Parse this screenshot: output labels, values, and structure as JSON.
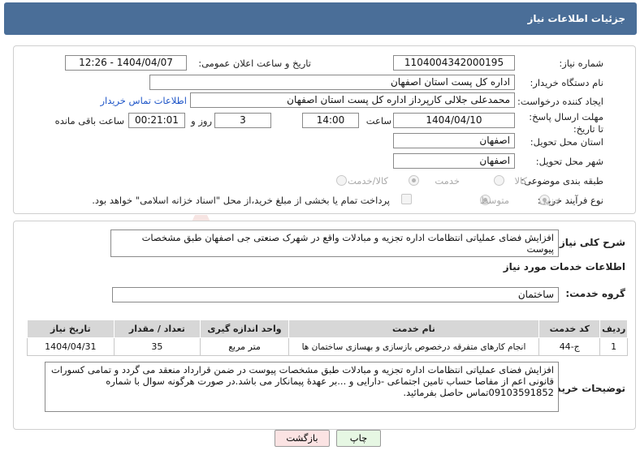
{
  "header": {
    "title": "جزئیات اطلاعات نیاز"
  },
  "fields": {
    "need_number_label": "شماره نیاز:",
    "need_number": "1104004342000195",
    "announce_label": "تاریخ و ساعت اعلان عمومی:",
    "announce_value": "1404/04/07 - 12:26",
    "buyer_org_label": "نام دستگاه خریدار:",
    "buyer_org": "اداره کل پست استان اصفهان",
    "creator_label": "ایجاد کننده درخواست:",
    "creator": "محمدعلی جلالی کارپرداز اداره کل پست استان اصفهان",
    "buyer_contact_link": "اطلاعات تماس خریدار",
    "deadline_label": "مهلت ارسال پاسخ: تا تاریخ:",
    "deadline_date": "1404/04/10",
    "time_label": "ساعت",
    "deadline_time": "14:00",
    "days_value": "3",
    "days_label": "روز و",
    "remaining_time": "00:21:01",
    "remaining_label": "ساعت باقی مانده",
    "province_label": "استان محل تحویل:",
    "province": "اصفهان",
    "city_label": "شهر محل تحویل:",
    "city": "اصفهان",
    "category_label": "طبقه بندی موضوعی:",
    "category_options": [
      "کالا",
      "خدمت",
      "کالا/خدمت"
    ],
    "category_selected": "خدمت",
    "process_label": "نوع فرآیند خرید :",
    "process_options": [
      "جزیی",
      "متوسط"
    ],
    "process_selected": "جزیی",
    "payment_note": "پرداخت تمام یا بخشی از مبلغ خرید،از محل \"اسناد خزانه اسلامی\" خواهد بود."
  },
  "summary": {
    "label": "شرح کلی نیاز:",
    "text": "افزایش فضای عملیاتی انتظامات اداره تجزیه و مبادلات واقع در شهرک صنعتی جی اصفهان طبق مشخصات پیوست"
  },
  "services": {
    "section_title": "اطلاعات خدمات مورد نیاز",
    "group_label": "گروه خدمت:",
    "group_value": "ساختمان",
    "columns": [
      "ردیف",
      "کد خدمت",
      "نام خدمت",
      "واحد اندازه گیری",
      "تعداد / مقدار",
      "تاریخ نیاز"
    ],
    "rows": [
      [
        "1",
        "ج-44",
        "انجام کارهای متفرقه درخصوص بازسازی و بهسازی ساختمان ها",
        "متر مربع",
        "35",
        "1404/04/31"
      ]
    ]
  },
  "buyer_notes": {
    "label": "توضیحات خریدار:",
    "text": "افزایش فضای عملیاتی انتظامات اداره تجزیه و مبادلات طبق مشخصات پیوست در ضمن قرارداد منعقد می گردد و تمامی کسورات قانونی اعم از مفاصا حساب تامین اجتماعی -دارایی و ...بر عهدهٔ پیمانکار می باشد.در صورت هرگونه سوال با شماره 09103591852تماس حاصل بفرمائید."
  },
  "buttons": {
    "print": "چاپ",
    "back": "بازگشت"
  },
  "watermark": "AriaTender.neT",
  "colors": {
    "header": "#4a6e98",
    "link": "#1f56c8",
    "back_button": "#fbe3e3",
    "print_button": "#e6f7e3",
    "watermark": "#c0392b"
  }
}
